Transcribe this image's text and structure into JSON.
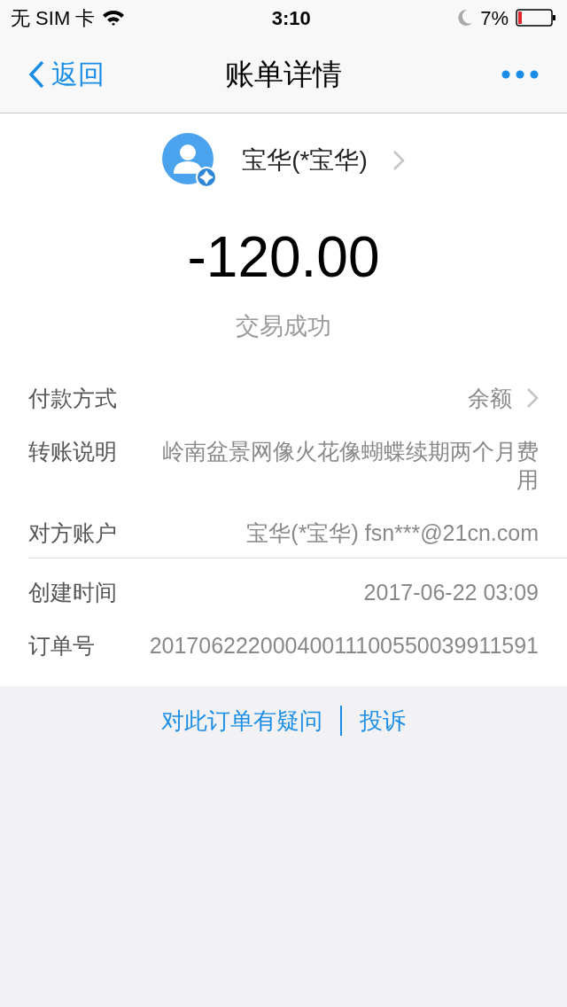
{
  "status_bar": {
    "carrier": "无 SIM 卡",
    "time": "3:10",
    "battery": "7%"
  },
  "nav": {
    "back": "返回",
    "title": "账单详情"
  },
  "payee": {
    "name": "宝华(*宝华)"
  },
  "amount": "-120.00",
  "status": "交易成功",
  "groups": [
    [
      {
        "label": "付款方式",
        "value": "余额",
        "kind": "link"
      },
      {
        "label": "转账说明",
        "value": "岭南盆景网像火花像蝴蝶续期两个月费用",
        "kind": "plain"
      },
      {
        "label": "对方账户",
        "value": "宝华(*宝华) fsn***@21cn.com",
        "kind": "plain"
      }
    ],
    [
      {
        "label": "创建时间",
        "value": "2017-06-22 03:09",
        "kind": "plain"
      },
      {
        "label": "订单号",
        "value": "20170622200040011100550039911591",
        "kind": "plain"
      }
    ]
  ],
  "footer_links": [
    "对此订单有疑问",
    "投诉"
  ]
}
